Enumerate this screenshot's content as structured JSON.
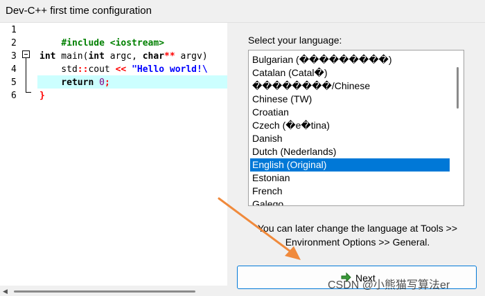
{
  "window": {
    "title": "Dev-C++ first time configuration"
  },
  "editor": {
    "line_numbers": [
      "1",
      "2",
      "3",
      "4",
      "5",
      "6"
    ],
    "lines": {
      "l1": "#include <iostream>",
      "l3_kw1": "int",
      "l3_fn": " main(",
      "l3_kw2": "int",
      "l3_a": " argc, ",
      "l3_kw3": "char",
      "l3_op": "**",
      "l3_b": " argv)",
      "l4_a": "    std",
      "l4_op1": "::",
      "l4_b": "cout ",
      "l4_op2": "<<",
      "l4_str": " \"Hello world!\\",
      "l5_kw": "    return",
      "l5_num": " 0",
      "l5_semi": ";",
      "l6": "}"
    }
  },
  "language_panel": {
    "label": "Select your language:",
    "items": [
      "Bulgarian (���������)",
      "Catalan (Catal�)",
      "��������/Chinese",
      "Chinese (TW)",
      "Croatian",
      "Czech (�e�tina)",
      "Danish",
      "Dutch (Nederlands)",
      "English (Original)",
      "Estonian",
      "French",
      "Galego"
    ],
    "selected": "English (Original)",
    "info_line1": "You can later change the language at Tools >>",
    "info_line2": "Environment Options >> General."
  },
  "next_button": {
    "label": "Next"
  },
  "watermark": "CSDN @小熊猫写算法er",
  "colors": {
    "accent": "#0078d7",
    "highlight_line": "#ccffff",
    "arrow": "#f08a3c"
  }
}
